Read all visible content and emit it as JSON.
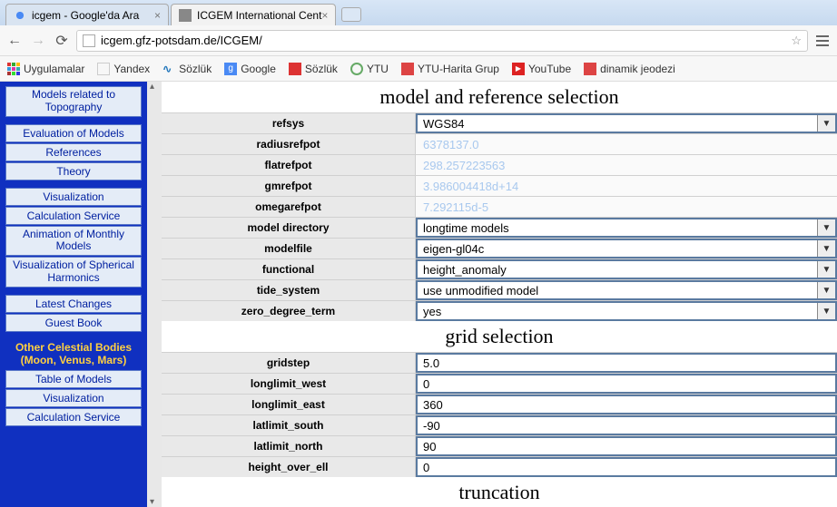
{
  "browser": {
    "tabs": [
      {
        "title": "icgem - Google'da Ara",
        "active": false
      },
      {
        "title": "ICGEM International Cent",
        "active": true
      }
    ],
    "url": "icgem.gfz-potsdam.de/ICGEM/",
    "bookmarks": [
      {
        "label": "Uygulamalar",
        "icon": "apps"
      },
      {
        "label": "Yandex",
        "icon": "yandex"
      },
      {
        "label": "Sözlük",
        "icon": "sozluk1"
      },
      {
        "label": "Google",
        "icon": "google"
      },
      {
        "label": "Sözlük",
        "icon": "sozluk2"
      },
      {
        "label": "YTU",
        "icon": "ytu"
      },
      {
        "label": "YTU-Harita Grup",
        "icon": "ytugrup"
      },
      {
        "label": "YouTube",
        "icon": "youtube"
      },
      {
        "label": "dinamik jeodezi",
        "icon": "jeodezi"
      }
    ]
  },
  "sidebar": {
    "group1": [
      "Models related to Topography"
    ],
    "group2": [
      "Evaluation of Models",
      "References",
      "Theory"
    ],
    "group3": [
      "Visualization",
      "Calculation Service",
      "Animation of Monthly Models",
      "Visualization of Spherical Harmonics"
    ],
    "group4": [
      "Latest Changes",
      "Guest Book"
    ],
    "section_label": "Other Celestial Bodies (Moon, Venus, Mars)",
    "group5": [
      "Table of Models",
      "Visualization",
      "Calculation Service"
    ]
  },
  "main": {
    "section1": {
      "title": "model and reference selection",
      "rows": [
        {
          "name": "refsys",
          "type": "select",
          "value": "WGS84"
        },
        {
          "name": "radiusrefpot",
          "type": "readonly",
          "value": "6378137.0"
        },
        {
          "name": "flatrefpot",
          "type": "readonly",
          "value": "298.257223563"
        },
        {
          "name": "gmrefpot",
          "type": "readonly",
          "value": "3.986004418d+14"
        },
        {
          "name": "omegarefpot",
          "type": "readonly",
          "value": "7.292115d-5"
        },
        {
          "name": "model directory",
          "type": "select",
          "value": "longtime models"
        },
        {
          "name": "modelfile",
          "type": "select",
          "value": "eigen-gl04c"
        },
        {
          "name": "functional",
          "type": "select",
          "value": "height_anomaly"
        },
        {
          "name": "tide_system",
          "type": "select",
          "value": "use unmodified model"
        },
        {
          "name": "zero_degree_term",
          "type": "select",
          "value": "yes"
        }
      ]
    },
    "section2": {
      "title": "grid selection",
      "rows": [
        {
          "name": "gridstep",
          "type": "input",
          "value": "5.0"
        },
        {
          "name": "longlimit_west",
          "type": "input",
          "value": "0"
        },
        {
          "name": "longlimit_east",
          "type": "input",
          "value": "360"
        },
        {
          "name": "latlimit_south",
          "type": "input",
          "value": "-90"
        },
        {
          "name": "latlimit_north",
          "type": "input",
          "value": "90"
        },
        {
          "name": "height_over_ell",
          "type": "input",
          "value": "0"
        }
      ]
    },
    "section3": {
      "title": "truncation"
    }
  }
}
